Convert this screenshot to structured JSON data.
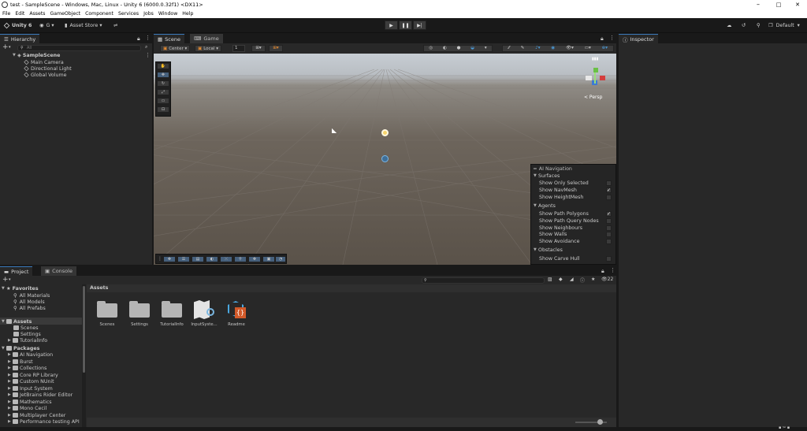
{
  "window": {
    "title": "test - SampleScene - Windows, Mac, Linux - Unity 6 (6000.0.32f1) <DX11>",
    "controls": [
      "–",
      "□",
      "✕"
    ]
  },
  "menu": [
    "File",
    "Edit",
    "Assets",
    "GameObject",
    "Component",
    "Services",
    "Jobs",
    "Window",
    "Help"
  ],
  "toolbar": {
    "account": "Unity 6",
    "g_label": "G ▾",
    "asset_store": "Asset Store ▾",
    "layout": "Default"
  },
  "hierarchy": {
    "tab": "Hierarchy",
    "search_placeholder": "All",
    "scene": "SampleScene",
    "items": [
      "Main Camera",
      "Directional Light",
      "Global Volume"
    ]
  },
  "scene": {
    "tabs": [
      "Scene",
      "Game"
    ],
    "pivot": "Center",
    "space": "Local",
    "snap": "1",
    "persp": "< Persp"
  },
  "ai_nav": {
    "title": "AI Navigation",
    "sections": [
      {
        "name": "Surfaces",
        "items": [
          {
            "label": "Show Only Selected",
            "checked": false
          },
          {
            "label": "Show NavMesh",
            "checked": true
          },
          {
            "label": "Show HeightMesh",
            "checked": false
          }
        ]
      },
      {
        "name": "Agents",
        "items": [
          {
            "label": "Show Path Polygons",
            "checked": true
          },
          {
            "label": "Show Path Query Nodes",
            "checked": false
          },
          {
            "label": "Show Neighbours",
            "checked": false
          },
          {
            "label": "Show Walls",
            "checked": false
          },
          {
            "label": "Show Avoidance",
            "checked": false
          }
        ]
      },
      {
        "name": "Obstacles",
        "items": [
          {
            "label": "Show Carve Hull",
            "checked": false
          }
        ]
      }
    ]
  },
  "inspector": {
    "tab": "Inspector"
  },
  "project": {
    "tabs": [
      "Project",
      "Console"
    ],
    "breadcrumb": "Assets",
    "count": "22",
    "favorites": {
      "label": "Favorites",
      "items": [
        "All Materials",
        "All Models",
        "All Prefabs"
      ]
    },
    "assets": {
      "label": "Assets",
      "items": [
        "Scenes",
        "Settings",
        "TutorialInfo"
      ]
    },
    "packages": {
      "label": "Packages",
      "items": [
        "AI Navigation",
        "Burst",
        "Collections",
        "Core RP Library",
        "Custom NUnit",
        "Input System",
        "JetBrains Rider Editor",
        "Mathematics",
        "Mono Cecil",
        "Multiplayer Center",
        "Performance testing API"
      ]
    },
    "grid": [
      "Scenes",
      "Settings",
      "TutorialInfo",
      "InputSyste...",
      "Readme"
    ]
  }
}
